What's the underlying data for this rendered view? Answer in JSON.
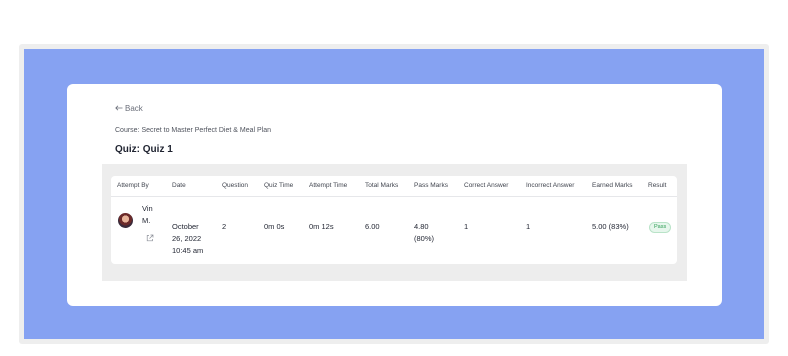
{
  "back_label": "Back",
  "course_label": "Course: Secret to Master Perfect Diet & Meal Plan",
  "quiz_title": "Quiz: Quiz 1",
  "table": {
    "headers": [
      "Attempt By",
      "Date",
      "Question",
      "Quiz Time",
      "Attempt Time",
      "Total Marks",
      "Pass Marks",
      "Correct Answer",
      "Incorrect Answer",
      "Earned Marks",
      "Result"
    ],
    "row": {
      "name_line1": "Vin",
      "name_line2": "M.",
      "date_line1": "October",
      "date_line2": "26, 2022",
      "date_line3": "10:45 am",
      "question": "2",
      "quiz_time": "0m 0s",
      "attempt_time": "0m 12s",
      "total_marks": "6.00",
      "pass_marks_line1": "4.80",
      "pass_marks_line2": "(80%)",
      "correct": "1",
      "incorrect": "1",
      "earned": "5.00 (83%)",
      "result": "Pass"
    }
  },
  "icons": {
    "back": "arrow-left-icon",
    "external": "external-link-icon"
  },
  "colors": {
    "background": "#86a2f2",
    "pass_badge": "#2f9e55"
  }
}
